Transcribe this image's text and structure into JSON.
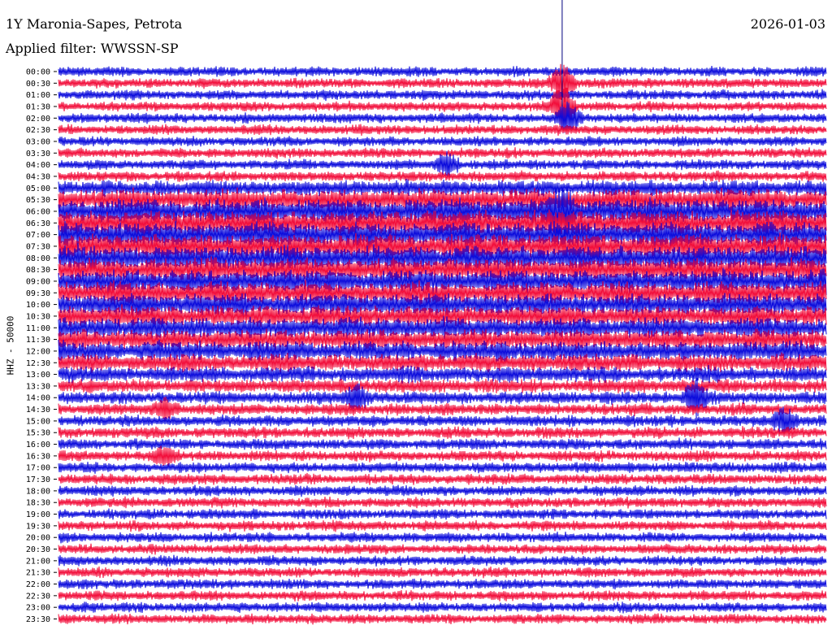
{
  "header": {
    "title": "1Y Maronia-Sapes, Petrota",
    "filter": "Applied filter: WWSSN-SP",
    "date": "2026-01-03"
  },
  "channel_label": "HHZ - 50000",
  "colors": {
    "trace_a": "#0b0bdc",
    "trace_b": "#f20d3a",
    "marker": "#000080"
  },
  "chart_data": {
    "type": "line",
    "title": "1Y Maronia-Sapes, Petrota",
    "subtitle": "Applied filter: WWSSN-SP",
    "date": "2026-01-03",
    "ylabel": "HHZ - 50000",
    "xlabel": "",
    "row_labels": [
      "00:00",
      "00:30",
      "01:00",
      "01:30",
      "02:00",
      "02:30",
      "03:00",
      "03:30",
      "04:00",
      "04:30",
      "05:00",
      "05:30",
      "06:00",
      "06:30",
      "07:00",
      "07:30",
      "08:00",
      "08:30",
      "09:00",
      "09:30",
      "10:00",
      "10:30",
      "11:00",
      "11:30",
      "12:00",
      "12:30",
      "13:00",
      "13:30",
      "14:00",
      "14:30",
      "15:00",
      "15:30",
      "16:00",
      "16:30",
      "17:00",
      "17:30",
      "18:00",
      "18:30",
      "19:00",
      "19:30",
      "20:00",
      "20:30",
      "21:00",
      "21:30",
      "22:00",
      "22:30",
      "23:00",
      "23:30"
    ],
    "row_colors": [
      "trace_a",
      "trace_b"
    ],
    "row_noise_level": [
      0.26,
      0.26,
      0.27,
      0.26,
      0.27,
      0.26,
      0.26,
      0.27,
      0.27,
      0.28,
      0.55,
      0.85,
      1.0,
      1.0,
      1.0,
      1.0,
      0.95,
      0.9,
      0.9,
      0.88,
      0.85,
      0.8,
      0.8,
      0.75,
      0.75,
      0.65,
      0.55,
      0.45,
      0.4,
      0.36,
      0.34,
      0.33,
      0.32,
      0.31,
      0.3,
      0.3,
      0.3,
      0.29,
      0.28,
      0.28,
      0.28,
      0.27,
      0.27,
      0.27,
      0.27,
      0.27,
      0.27,
      0.27
    ],
    "events": [
      {
        "row": 1,
        "minute": 19.7,
        "amplitude": 1.6
      },
      {
        "row": 3,
        "minute": 19.7,
        "amplitude": 2.0
      },
      {
        "row": 4,
        "minute": 19.9,
        "amplitude": 1.4
      },
      {
        "row": 8,
        "minute": 15.2,
        "amplitude": 0.9
      },
      {
        "row": 12,
        "minute": 19.7,
        "amplitude": 0.7
      },
      {
        "row": 28,
        "minute": 11.6,
        "amplitude": 0.8
      },
      {
        "row": 28,
        "minute": 24.9,
        "amplitude": 1.1
      },
      {
        "row": 29,
        "minute": 4.2,
        "amplitude": 0.7
      },
      {
        "row": 30,
        "minute": 28.4,
        "amplitude": 0.9
      },
      {
        "row": 33,
        "minute": 4.2,
        "amplitude": 0.6
      }
    ],
    "vertical_marker_minute": 19.7
  }
}
